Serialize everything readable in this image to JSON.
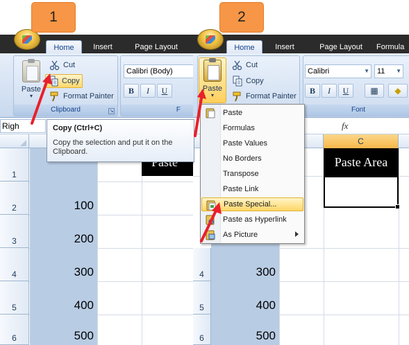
{
  "panel1": {
    "step": "1",
    "tabs": [
      "Home",
      "Insert",
      "Page Layout"
    ],
    "clipboard": {
      "paste_label": "Paste",
      "cut_label": "Cut",
      "copy_label": "Copy",
      "format_painter_label": "Format Painter",
      "group_label": "Clipboard"
    },
    "font": {
      "name": "Calibri (Body)",
      "group_partial": "F"
    },
    "font_buttons": [
      "B",
      "I",
      "U"
    ],
    "namebox_partial": "Righ",
    "tooltip": {
      "title": "Copy (Ctrl+C)",
      "body": "Copy the selection and put it on the Clipboard."
    },
    "row_headers": [
      "1",
      "2",
      "3",
      "4",
      "5",
      "6"
    ],
    "header_cell_partial": "Paste",
    "values": [
      "100",
      "200",
      "300",
      "400",
      "500"
    ]
  },
  "panel2": {
    "step": "2",
    "tabs": [
      "Home",
      "Insert",
      "Page Layout",
      "Formula"
    ],
    "paste_label": "Paste",
    "clipboard": {
      "cut_label": "Cut",
      "copy_label": "Copy",
      "format_painter_label": "Format Painter"
    },
    "font": {
      "name": "Calibri",
      "size": "11",
      "group_label": "Font"
    },
    "font_buttons": [
      "B",
      "I",
      "U"
    ],
    "fx_label": "fx",
    "col_header": "C",
    "paste_area_label": "Paste Area",
    "menu_items": [
      {
        "label": "Paste",
        "icon": "paste-icon"
      },
      {
        "label": "Formulas",
        "icon": ""
      },
      {
        "label": "Paste Values",
        "icon": ""
      },
      {
        "label": "No Borders",
        "icon": ""
      },
      {
        "label": "Transpose",
        "icon": ""
      },
      {
        "label": "Paste Link",
        "icon": ""
      },
      {
        "label": "Paste Special...",
        "icon": "paste-special-icon"
      },
      {
        "label": "Paste as Hyperlink",
        "icon": "paste-hyperlink-icon"
      },
      {
        "label": "As Picture",
        "icon": "picture-icon"
      }
    ],
    "row_headers": [
      "4",
      "5",
      "6"
    ],
    "values": [
      "300",
      "400",
      "500"
    ]
  },
  "colors": {
    "badge": "#f79646",
    "selection": "#b8cce4",
    "arrow": "#e8202a",
    "header_fill": "#000000"
  }
}
